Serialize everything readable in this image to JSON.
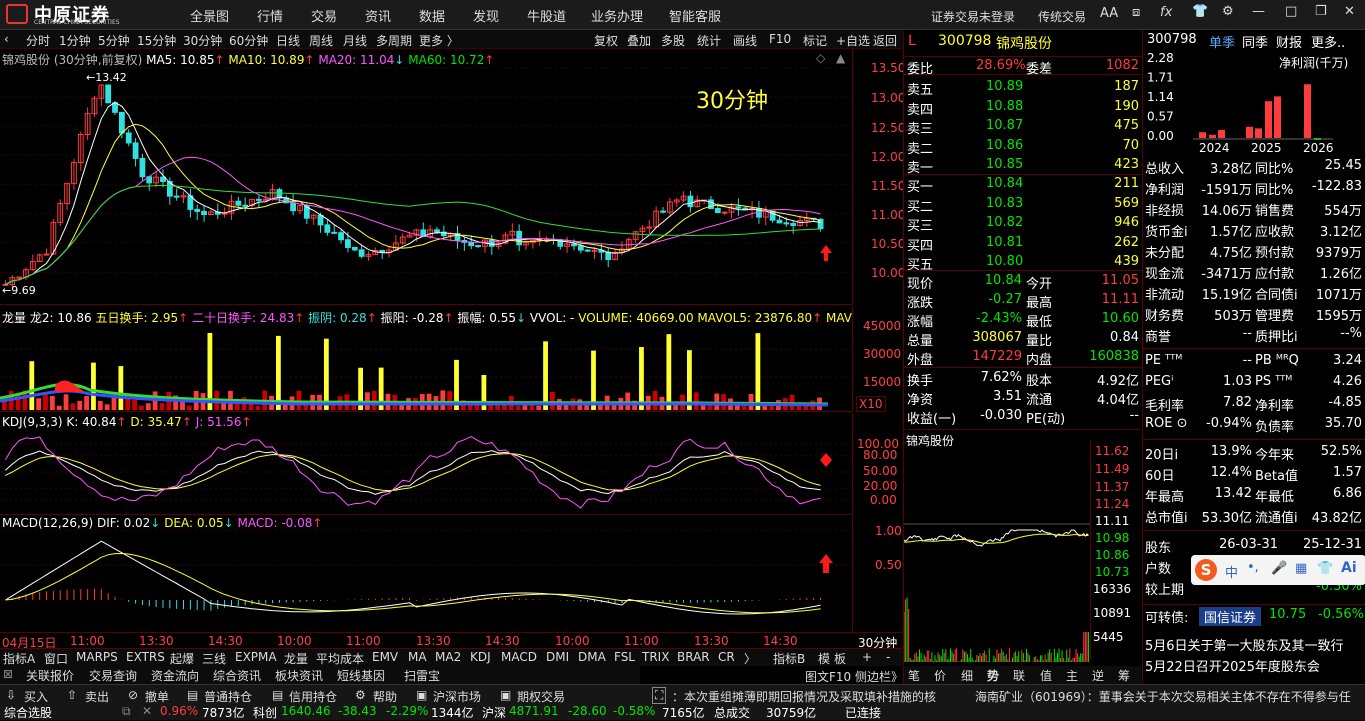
{
  "topbar": {
    "brand": "中原证券",
    "brand_sub": "CENTRAL CHINA SECURITIES",
    "menus": [
      "全景图",
      "行情",
      "交易",
      "资讯",
      "数据",
      "发现",
      "牛股道",
      "业务办理",
      "智能客服"
    ],
    "login": "证券交易未登录",
    "mode": "传统交易",
    "font_btn": "AA"
  },
  "periods": [
    "分时",
    "1分钟",
    "5分钟",
    "15分钟",
    "30分钟",
    "60分钟",
    "日线",
    "周线",
    "月线",
    "多周期",
    "更多 〉"
  ],
  "active_period": "30分钟",
  "chart_tools": [
    "复权",
    "叠加",
    "多股",
    "统计",
    "画线",
    "F10",
    "标记",
    "+自选",
    "返回"
  ],
  "main_chart": {
    "title": "锦鸡股份 (30分钟,前复权)",
    "ma5": "MA5: 10.85",
    "ma10": "MA10: 10.89",
    "ma20": "MA20: 11.04",
    "ma60": "MA60: 10.72",
    "overlay": "30分钟",
    "high_mark": "13.42",
    "low_mark": "9.69",
    "y_ticks": [
      "13.50",
      "13.00",
      "12.50",
      "12.00",
      "11.50",
      "11.00",
      "10.50",
      "10.00"
    ]
  },
  "vol_chart": {
    "label": "龙量",
    "items": [
      "龙2: 10.86",
      "五日换手: 2.95",
      "二十日换手: 24.83",
      "振阴: 0.28",
      "振阳: -0.28",
      "振幅: 0.55",
      "VVOL: -",
      "VOLUME: 40669.00",
      "MAVOL5: 23876.80",
      "MAV"
    ],
    "y_ticks": [
      "45000",
      "30000",
      "15000"
    ],
    "unit": "X10"
  },
  "kdj_chart": {
    "label": "KDJ(9,3,3)",
    "k": "K: 40.84",
    "d": "D: 35.47",
    "j": "J: 51.56",
    "y_ticks": [
      "100.00",
      "80.00",
      "50.00",
      "20.00",
      "0.00"
    ]
  },
  "macd_chart": {
    "label": "MACD(12,26,9)",
    "dif": "DIF: 0.02",
    "dea": "DEA: 0.05",
    "macd": "MACD: -0.08",
    "y_ticks": [
      "1.00",
      "0.50"
    ]
  },
  "time_axis": [
    "04月15日",
    "11:00",
    "13:30",
    "14:30",
    "10:00",
    "11:00",
    "13:30",
    "14:30",
    "10:00",
    "11:00",
    "13:30",
    "14:30"
  ],
  "period_corner": "30分钟",
  "indicator_tabs": [
    "指标A",
    "窗口",
    "MARPS",
    "EXTRS",
    "起爆",
    "三线",
    "EXPMA",
    "龙量",
    "平均成本",
    "EMV",
    "MA",
    "MA2",
    "KDJ",
    "MACD",
    "DMI",
    "DMA",
    "FSL",
    "TRIX",
    "BRAR",
    "CR",
    "〉",
    "指标B",
    "模",
    "板"
  ],
  "func_tabs": [
    "关联报价",
    "交易查询",
    "资金流向",
    "综合资讯",
    "板块资讯",
    "短线基因",
    "扫雷宝"
  ],
  "footer_links": [
    "图文F10",
    "侧边栏"
  ],
  "quote": {
    "code": "300798",
    "name": "锦鸡股份",
    "flag": "L",
    "weibi": {
      "label": "委比",
      "value": "28.69%",
      "label2": "委差",
      "value2": "1082"
    },
    "sells": [
      {
        "l": "卖五",
        "p": "10.89",
        "v": "187"
      },
      {
        "l": "卖四",
        "p": "10.88",
        "v": "190"
      },
      {
        "l": "卖三",
        "p": "10.87",
        "v": "475"
      },
      {
        "l": "卖二",
        "p": "10.86",
        "v": "70"
      },
      {
        "l": "卖一",
        "p": "10.85",
        "v": "423"
      }
    ],
    "buys": [
      {
        "l": "买一",
        "p": "10.84",
        "v": "211"
      },
      {
        "l": "买二",
        "p": "10.83",
        "v": "569"
      },
      {
        "l": "买三",
        "p": "10.82",
        "v": "946"
      },
      {
        "l": "买四",
        "p": "10.81",
        "v": "262"
      },
      {
        "l": "买五",
        "p": "10.80",
        "v": "439"
      }
    ],
    "stats": [
      {
        "a": "现价",
        "b": "10.84",
        "c": "今开",
        "d": "11.05"
      },
      {
        "a": "涨跌",
        "b": "-0.27",
        "c": "最高",
        "d": "11.11"
      },
      {
        "a": "涨幅",
        "b": "-2.43%",
        "c": "最低",
        "d": "10.60"
      },
      {
        "a": "总量",
        "b": "308067",
        "c": "量比",
        "d": "0.84"
      },
      {
        "a": "外盘",
        "b": "147229",
        "c": "内盘",
        "d": "160838"
      }
    ],
    "stats2": [
      {
        "a": "换手",
        "b": "7.62%",
        "c": "股本",
        "d": "4.92亿"
      },
      {
        "a": "净资",
        "b": "3.51",
        "c": "流通",
        "d": "4.04亿"
      },
      {
        "a": "收益(一)",
        "b": "-0.030",
        "c": "PE(动)",
        "d": "--"
      }
    ]
  },
  "mini": {
    "title": "锦鸡股份",
    "y_ticks": [
      "11.62",
      "11.49",
      "11.37",
      "11.24",
      "11.11",
      "10.98",
      "10.86",
      "10.73"
    ],
    "vol_ticks": [
      "16336",
      "10891",
      "5445"
    ],
    "tabs": [
      "笔",
      "价",
      "细",
      "势",
      "联",
      "值",
      "主",
      "逆",
      "筹"
    ]
  },
  "fin": {
    "code": "300798",
    "tabs": [
      "单季",
      "同季",
      "财报",
      "更多.."
    ],
    "bar_title": "净利润(千万)",
    "yvals": [
      "2.28",
      "1.71",
      "1.14",
      "0.57",
      "0.00"
    ],
    "years": [
      "2024",
      "2025",
      "2026"
    ],
    "rows": [
      [
        "总收入",
        "3.28亿",
        "同比%",
        "25.45"
      ],
      [
        "净利润",
        "-1591万",
        "同比%",
        "-122.83"
      ],
      [
        "非经损",
        "14.06万",
        "销售费",
        "554万"
      ],
      [
        "货币金i",
        "1.57亿",
        "应收款",
        "3.12亿"
      ],
      [
        "未分配",
        "4.75亿",
        "预付款",
        "9379万"
      ],
      [
        "现金流",
        "-3471万",
        "应付款",
        "1.26亿"
      ],
      [
        "非流动",
        "15.19亿",
        "合同债i",
        "1071万"
      ],
      [
        "财务费",
        "503万",
        "管理费",
        "1595万"
      ],
      [
        "商誉",
        "--",
        "质押比i",
        "--%"
      ]
    ],
    "rows2": [
      [
        "PE ᵀᵀᴹ",
        "--",
        "PB ᴹᴿQ",
        "3.24"
      ],
      [
        "PEGⁱ",
        "1.03",
        "PS ᵀᵀᴹ",
        "4.26"
      ],
      [
        "毛利率",
        "7.82",
        "净利率",
        "-4.85"
      ],
      [
        "ROE ⊙",
        "-0.94%",
        "负债率",
        "35.70"
      ]
    ],
    "rows3": [
      [
        "20日i",
        "13.9%",
        "今年来",
        "52.5%"
      ],
      [
        "60日",
        "12.4%",
        "Beta值",
        "1.57"
      ],
      [
        "年最高",
        "13.42",
        "年最低",
        "6.86"
      ],
      [
        "总市值i",
        "53.30亿",
        "流通值i",
        "43.82亿"
      ]
    ],
    "holder": {
      "label": "股东",
      "d1": "26-03-31",
      "d2": "25-12-31"
    },
    "hushu": "户数",
    "jiaoshang": "较上期",
    "jiaoshang_v": "-0.30%",
    "conv": {
      "label": "可转债:",
      "name": "国信证券",
      "price": "10.75",
      "pct": "-0.56%"
    },
    "news": [
      "5月6日关于第一大股东及其一致行",
      "5月22日召开2025年度股东会"
    ]
  },
  "bottom": {
    "buttons": [
      "买入",
      "卖出",
      "撤单",
      "普通持仓",
      "信用持仓",
      "帮助",
      "沪深市场",
      "期权交易"
    ],
    "scroll1": "：本次重组摊薄即期回报情况及采取填补措施的核",
    "scroll2": "海南矿业（601969）：董事会关于本次交易相关主体不存在不得参与任"
  },
  "status": {
    "left": "综合选股",
    "items": [
      "0.96%",
      "7873亿",
      "科创",
      "1640.46",
      "-38.43",
      "-2.29%",
      "1344亿",
      "沪深",
      "4871.91",
      "-28.60",
      "-0.58%",
      "7165亿",
      "总成交",
      "30759亿",
      "已连接"
    ]
  },
  "ai": {
    "s": "S",
    "zh": "中",
    "ai": "Ai"
  },
  "colors": {
    "up": "#ff3c3c",
    "down": "#00e600",
    "ma5": "#ffffff",
    "ma10": "#ffff33",
    "ma20": "#ff55ff",
    "ma60": "#33dd33"
  }
}
